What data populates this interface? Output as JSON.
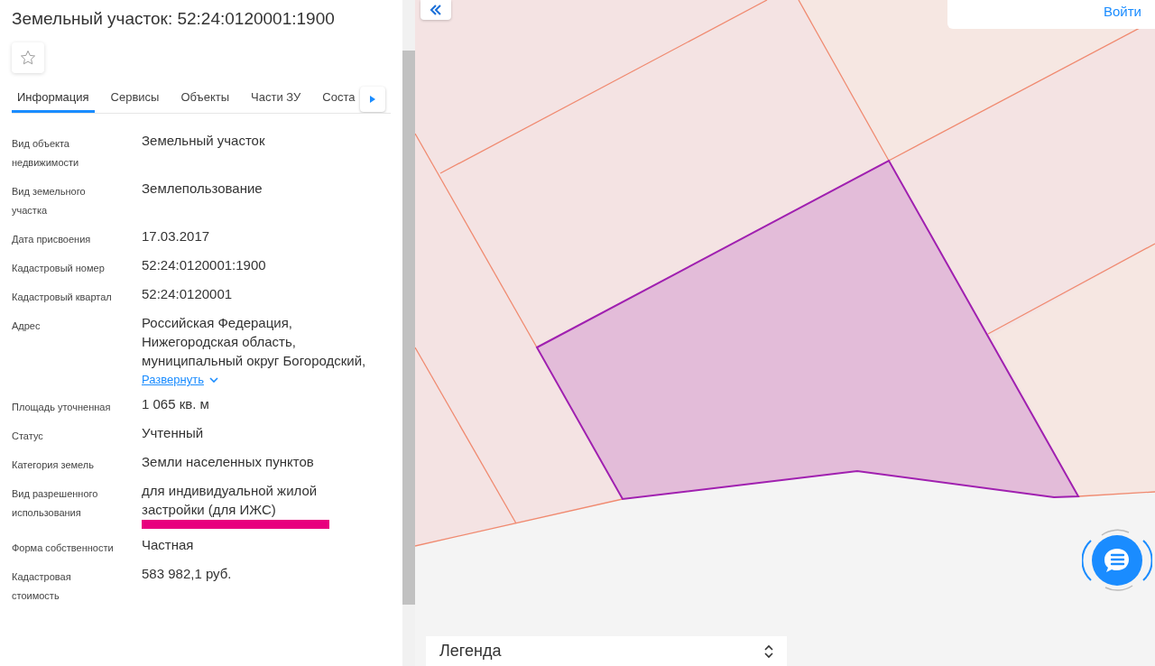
{
  "title": "Земельный участок: 52:24:0120001:1900",
  "favorite": {
    "on": false
  },
  "tabs": [
    {
      "label": "Информация",
      "selected": true
    },
    {
      "label": "Сервисы",
      "selected": false
    },
    {
      "label": "Объекты",
      "selected": false
    },
    {
      "label": "Части ЗУ",
      "selected": false
    },
    {
      "label": "Соста",
      "selected": false
    }
  ],
  "fields": [
    {
      "label": "Вид объекта недвижимости",
      "value": "Земельный участок"
    },
    {
      "label": "Вид земельного участка",
      "value": "Землепользование"
    },
    {
      "label": "Дата присвоения",
      "value": "17.03.2017"
    },
    {
      "label": "Кадастровый номер",
      "value": "52:24:0120001:1900"
    },
    {
      "label": "Кадастровый квартал",
      "value": "52:24:0120001"
    },
    {
      "label": "Адрес",
      "value": "Российская Федерация, Нижегородская область, муниципальный округ Богородский,",
      "expand_link": "Развернуть"
    },
    {
      "label": "Площадь уточненная",
      "value": "1 065 кв. м"
    },
    {
      "label": "Статус",
      "value": "Учтенный"
    },
    {
      "label": "Категория земель",
      "value": "Земли населенных пунктов"
    },
    {
      "label": "Вид разрешенного использования",
      "value": "для индивидуальной жилой застройки (для ИЖС)",
      "highlighted": true
    },
    {
      "label": "Форма собственности",
      "value": "Частная"
    },
    {
      "label": "Кадастровая стоимость",
      "value": "583 982,1 руб."
    }
  ],
  "map": {
    "login": "Войти",
    "legend": {
      "title": "Легенда",
      "expanded": false
    }
  }
}
